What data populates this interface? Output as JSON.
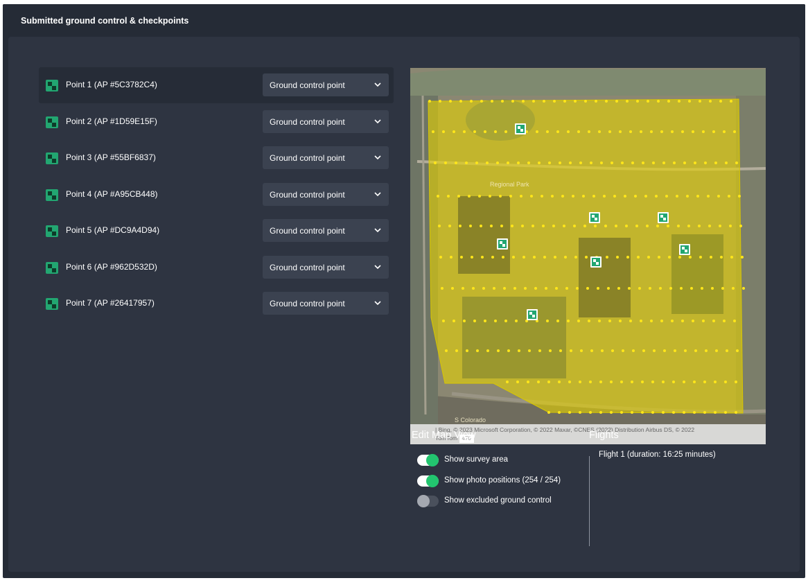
{
  "header": {
    "title": "Submitted ground control & checkpoints"
  },
  "points": [
    {
      "label": "Point 1 (AP #5C3782C4)",
      "type": "Ground control point"
    },
    {
      "label": "Point 2 (AP #1D59E15F)",
      "type": "Ground control point"
    },
    {
      "label": "Point 3 (AP #55BF6837)",
      "type": "Ground control point"
    },
    {
      "label": "Point 4 (AP #A95CB448)",
      "type": "Ground control point"
    },
    {
      "label": "Point 5 (AP #DC9A4D94)",
      "type": "Ground control point"
    },
    {
      "label": "Point 6 (AP #962D532D)",
      "type": "Ground control point"
    },
    {
      "label": "Point 7 (AP #26417957)",
      "type": "Ground control point"
    }
  ],
  "map": {
    "park_label": "Regional Park",
    "road_label": "S Colorado",
    "attribution_line1": "| Bing, © 2023 Microsoft Corporation, © 2022 Maxar, ©CNES (2022) Distribution Airbus DS, © 2022",
    "attribution_line2": "TomTom",
    "attribution_badge": "470"
  },
  "edit_map_view": {
    "title": "Edit Map View",
    "toggles": [
      {
        "label": "Show survey area",
        "on": true
      },
      {
        "label": "Show photo positions (254 / 254)",
        "on": true
      },
      {
        "label": "Show excluded ground control",
        "on": false
      }
    ]
  },
  "flights": {
    "title": "Flights",
    "items": [
      "Flight 1 (duration: 16:25 minutes)"
    ]
  },
  "colors": {
    "background": "#252b36",
    "panel": "#2e3441",
    "select": "#3b4250",
    "accent_green": "#22c56f",
    "marker_green": "#22a671",
    "survey_area": "#e8d400",
    "photo_dot": "#ffe61a"
  },
  "icons": {
    "point": "checkered-marker-icon",
    "select": "chevron-down-icon",
    "map_marker": "ground-control-marker-icon"
  }
}
